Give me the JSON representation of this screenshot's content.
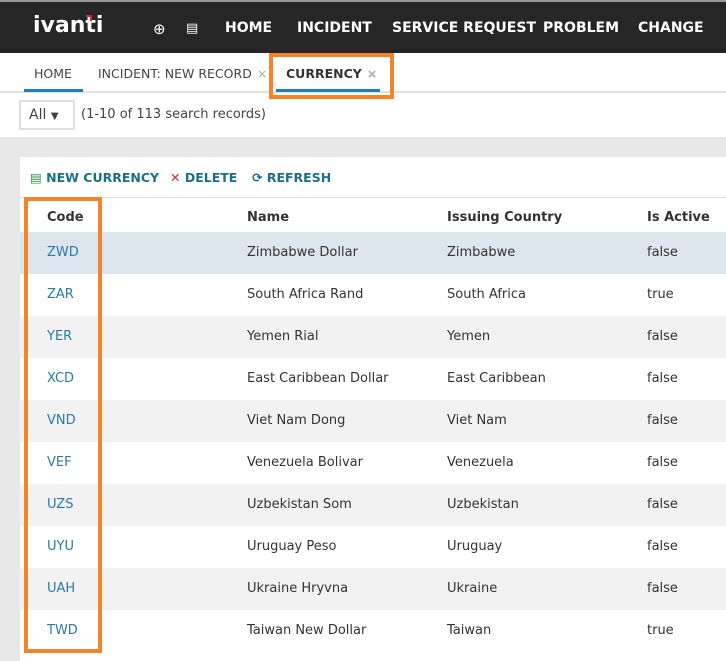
{
  "header": {
    "logo": "ivanti",
    "nav": [
      "HOME",
      "INCIDENT",
      "SERVICE REQUEST",
      "PROBLEM",
      "CHANGE"
    ]
  },
  "tabs": [
    {
      "label": "HOME"
    },
    {
      "label": "INCIDENT: NEW RECORD"
    },
    {
      "label": "CURRENCY"
    }
  ],
  "close_glyph": "×",
  "filter": {
    "value": "All",
    "count": "(1-10 of 113 search records)"
  },
  "toolbar": {
    "new": "NEW CURRENCY",
    "delete": "DELETE",
    "refresh": "REFRESH"
  },
  "columns": [
    "Code",
    "Name",
    "Issuing Country",
    "Is Active"
  ],
  "rows": [
    [
      "ZWD",
      "Zimbabwe Dollar",
      "Zimbabwe",
      "false"
    ],
    [
      "ZAR",
      "South Africa Rand",
      "South Africa",
      "true"
    ],
    [
      "YER",
      "Yemen Rial",
      "Yemen",
      "false"
    ],
    [
      "XCD",
      "East Caribbean Dollar",
      "East Caribbean",
      "false"
    ],
    [
      "VND",
      "Viet Nam Dong",
      "Viet Nam",
      "false"
    ],
    [
      "VEF",
      "Venezuela Bolivar",
      "Venezuela",
      "false"
    ],
    [
      "UZS",
      "Uzbekistan Som",
      "Uzbekistan",
      "false"
    ],
    [
      "UYU",
      "Uruguay Peso",
      "Uruguay",
      "false"
    ],
    [
      "UAH",
      "Ukraine Hryvna",
      "Ukraine",
      "false"
    ],
    [
      "TWD",
      "Taiwan New Dollar",
      "Taiwan",
      "true"
    ]
  ]
}
